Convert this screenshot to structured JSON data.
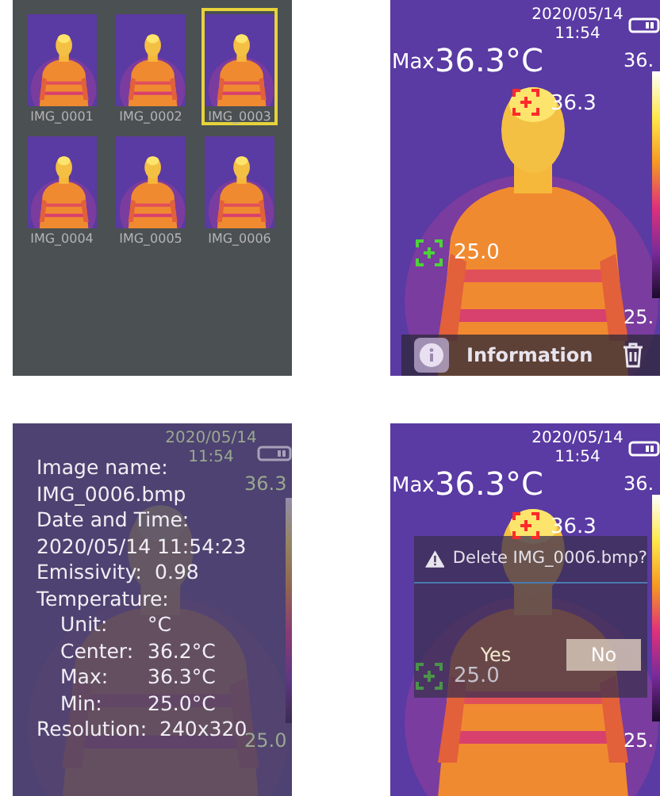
{
  "gallery": {
    "thumbnails": [
      {
        "label": "IMG_0001",
        "selected": false
      },
      {
        "label": "IMG_0002",
        "selected": false
      },
      {
        "label": "IMG_0003",
        "selected": true
      },
      {
        "label": "IMG_0004",
        "selected": false
      },
      {
        "label": "IMG_0005",
        "selected": false
      },
      {
        "label": "IMG_0006",
        "selected": false
      }
    ]
  },
  "viewer": {
    "date": "2020/05/14",
    "time": "11:54",
    "max_label": "Max",
    "max_value": "36.3°C",
    "scale_max": "36.",
    "scale_min": "25.",
    "spots": [
      {
        "kind": "hot",
        "value": "36.3"
      },
      {
        "kind": "cold",
        "value": "25.0"
      }
    ],
    "toolbar": {
      "label": "Information"
    }
  },
  "info_screen": {
    "backdrop": {
      "date": "2020/05/14",
      "time": "11:54",
      "scale_max": "36.3",
      "scale_min": "25.0"
    },
    "fields": [
      {
        "label": "Image name:"
      },
      {
        "label": "IMG_0006.bmp"
      },
      {
        "label": "Date and Time:"
      },
      {
        "label": "2020/05/14 11:54:23"
      },
      {
        "label": "Emissivity:",
        "value": "0.98"
      },
      {
        "label": "Temperature:",
        "children": [
          {
            "label": "Unit:",
            "value": "°C"
          },
          {
            "label": "Center:",
            "value": "36.2°C"
          },
          {
            "label": "Max:",
            "value": "36.3°C"
          },
          {
            "label": "Min:",
            "value": "25.0°C"
          }
        ]
      },
      {
        "label": "Resolution:",
        "value": "240x320"
      }
    ]
  },
  "delete_screen": {
    "date": "2020/05/14",
    "time": "11:54",
    "max_label": "Max",
    "max_value": "36.3°C",
    "scale_max": "36.",
    "scale_min": "25.",
    "spots": [
      {
        "kind": "hot",
        "value": "36.3"
      },
      {
        "kind": "cold",
        "value": "25.0"
      }
    ],
    "dialog": {
      "message": "Delete IMG_0006.bmp?",
      "buttons": [
        {
          "label": "Yes",
          "selected": false
        },
        {
          "label": "No",
          "selected": true
        }
      ]
    }
  }
}
